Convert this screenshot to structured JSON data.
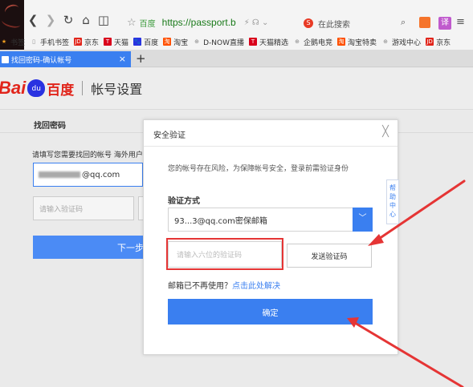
{
  "browser": {
    "nav": {
      "back": "❮",
      "forward": "❯",
      "refresh": "↻",
      "home": "⌂",
      "reader": "◫"
    },
    "address": {
      "star": "☆",
      "site_label": "百度",
      "url": "https://passport.b",
      "actions": "⚡  ☊  ⌄"
    },
    "search": {
      "logo": "S",
      "placeholder": "在此搜索",
      "icon": "⌕"
    },
    "extension_b": "译",
    "menu": "≡",
    "bookmarks": [
      {
        "label": "书签",
        "icon": "star-icon",
        "color": "#f2a020",
        "glyph": "★"
      },
      {
        "label": "手机书签",
        "icon": "phone-icon",
        "color": "#888888",
        "glyph": "▯"
      },
      {
        "label": "京东",
        "icon": "jd-icon",
        "color": "#e1251b",
        "glyph": "JD"
      },
      {
        "label": "天猫",
        "icon": "tmall-icon",
        "color": "#d9001b",
        "glyph": "T"
      },
      {
        "label": "百度",
        "icon": "baidu-icon",
        "color": "#2932e1",
        "glyph": "🐾"
      },
      {
        "label": "淘宝",
        "icon": "taobao-icon",
        "color": "#ff5000",
        "glyph": "淘"
      },
      {
        "label": "D-NOW直播",
        "icon": "globe-icon",
        "color": "#888888",
        "glyph": "⊕"
      },
      {
        "label": "天猫精选",
        "icon": "tmall-icon",
        "color": "#d9001b",
        "glyph": "T"
      },
      {
        "label": "企鹅电竞",
        "icon": "globe-icon",
        "color": "#888888",
        "glyph": "⊕"
      },
      {
        "label": "淘宝特卖",
        "icon": "taobao-icon",
        "color": "#ff5000",
        "glyph": "淘"
      },
      {
        "label": "游戏中心",
        "icon": "globe-icon",
        "color": "#888888",
        "glyph": "⊕"
      },
      {
        "label": "京东",
        "icon": "jd-icon",
        "color": "#e1251b",
        "glyph": "JD"
      }
    ],
    "tab": {
      "title": "找回密码-确认帐号",
      "close": "×"
    },
    "new_tab": "+"
  },
  "page": {
    "logo_bai": "Bai",
    "logo_du": "du",
    "logo_cn": "百度",
    "header_title": "帐号设置",
    "sub_title": "找回密码",
    "desc": "请填写您需要找回的帐号 海外用户请",
    "email_value": "@qq.com",
    "code_placeholder": "请输入验证码",
    "next_label": "下一步"
  },
  "dialog": {
    "title": "安全验证",
    "close": "╳",
    "desc": "您的帐号存在风险，为保障帐号安全，登录前需验证身份",
    "help_tab": "帮助中心",
    "method_label": "验证方式",
    "method_value": "93...3@qq.com密保邮箱",
    "method_arrow": "﹀",
    "code_placeholder": "请输入六位的验证码",
    "send_button": "发送验证码",
    "mail_unused_text": "邮箱已不再使用？",
    "mail_unused_link": "点击此处解决",
    "confirm_button": "确定"
  },
  "colors": {
    "accent": "#3a7ff0",
    "annotation_red": "#e53535",
    "baidu_red": "#e1251b",
    "baidu_blue": "#2932e1"
  }
}
